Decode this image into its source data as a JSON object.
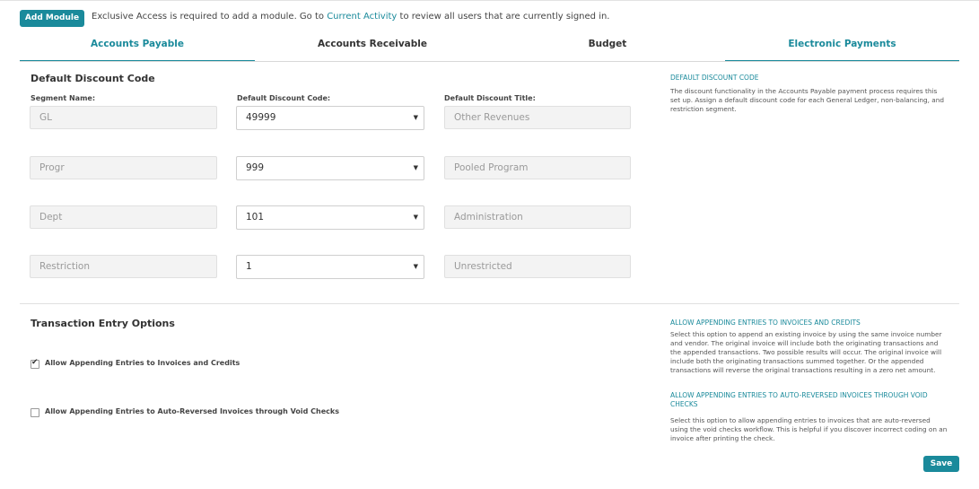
{
  "header": {
    "add_module_label": "Add Module",
    "notice_prefix": "Exclusive Access is required to add a module. Go to ",
    "notice_link": "Current Activity",
    "notice_suffix": " to review all users that are currently signed in."
  },
  "tabs": [
    {
      "label": "Accounts Payable",
      "active": true
    },
    {
      "label": "Accounts Receivable",
      "active": false
    },
    {
      "label": "Budget",
      "active": false
    },
    {
      "label": "Electronic Payments",
      "active": true
    }
  ],
  "discount": {
    "section_title": "Default Discount Code",
    "col_segment": "Segment Name:",
    "col_code": "Default Discount Code:",
    "col_title": "Default Discount Title:",
    "rows": [
      {
        "segment": "GL",
        "code": "49999",
        "title": "Other Revenues"
      },
      {
        "segment": "Progr",
        "code": "999",
        "title": "Pooled Program"
      },
      {
        "segment": "Dept",
        "code": "101",
        "title": "Administration"
      },
      {
        "segment": "Restriction",
        "code": "1",
        "title": "Unrestricted"
      }
    ],
    "help_title": "DEFAULT DISCOUNT CODE",
    "help_lines": [
      "The discount functionality in the Accounts Payable payment process requires this",
      "set up. Assign a default discount code for each General Ledger, non-balancing, and",
      "restriction segment."
    ]
  },
  "transaction": {
    "section_title": "Transaction Entry Options",
    "option1_label": "Allow Appending Entries to Invoices and Credits",
    "option1_checked": true,
    "option2_label": "Allow Appending Entries to Auto-Reversed Invoices through Void Checks",
    "option2_checked": false,
    "help1_title": "ALLOW APPENDING ENTRIES TO INVOICES AND CREDITS",
    "help1_lines": [
      "Select this option to append an existing invoice by using the same invoice number",
      "and vendor. The original invoice will include both the originating transactions and",
      "the appended transactions. Two possible results will occur. The original invoice will",
      "include both the originating transactions summed together. Or the appended",
      "transactions will reverse the original transactions resulting in a zero net amount."
    ],
    "help2_title_lines": [
      "ALLOW APPENDING ENTRIES TO AUTO-REVERSED INVOICES THROUGH VOID",
      "CHECKS"
    ],
    "help2_lines": [
      "Select this option to allow appending entries to invoices that are auto-reversed",
      "using the void checks workflow. This is helpful if you discover incorrect coding on an",
      "invoice after printing the check."
    ]
  },
  "footer": {
    "save_label": "Save"
  },
  "colors": {
    "accent": "#1a8a9b"
  }
}
